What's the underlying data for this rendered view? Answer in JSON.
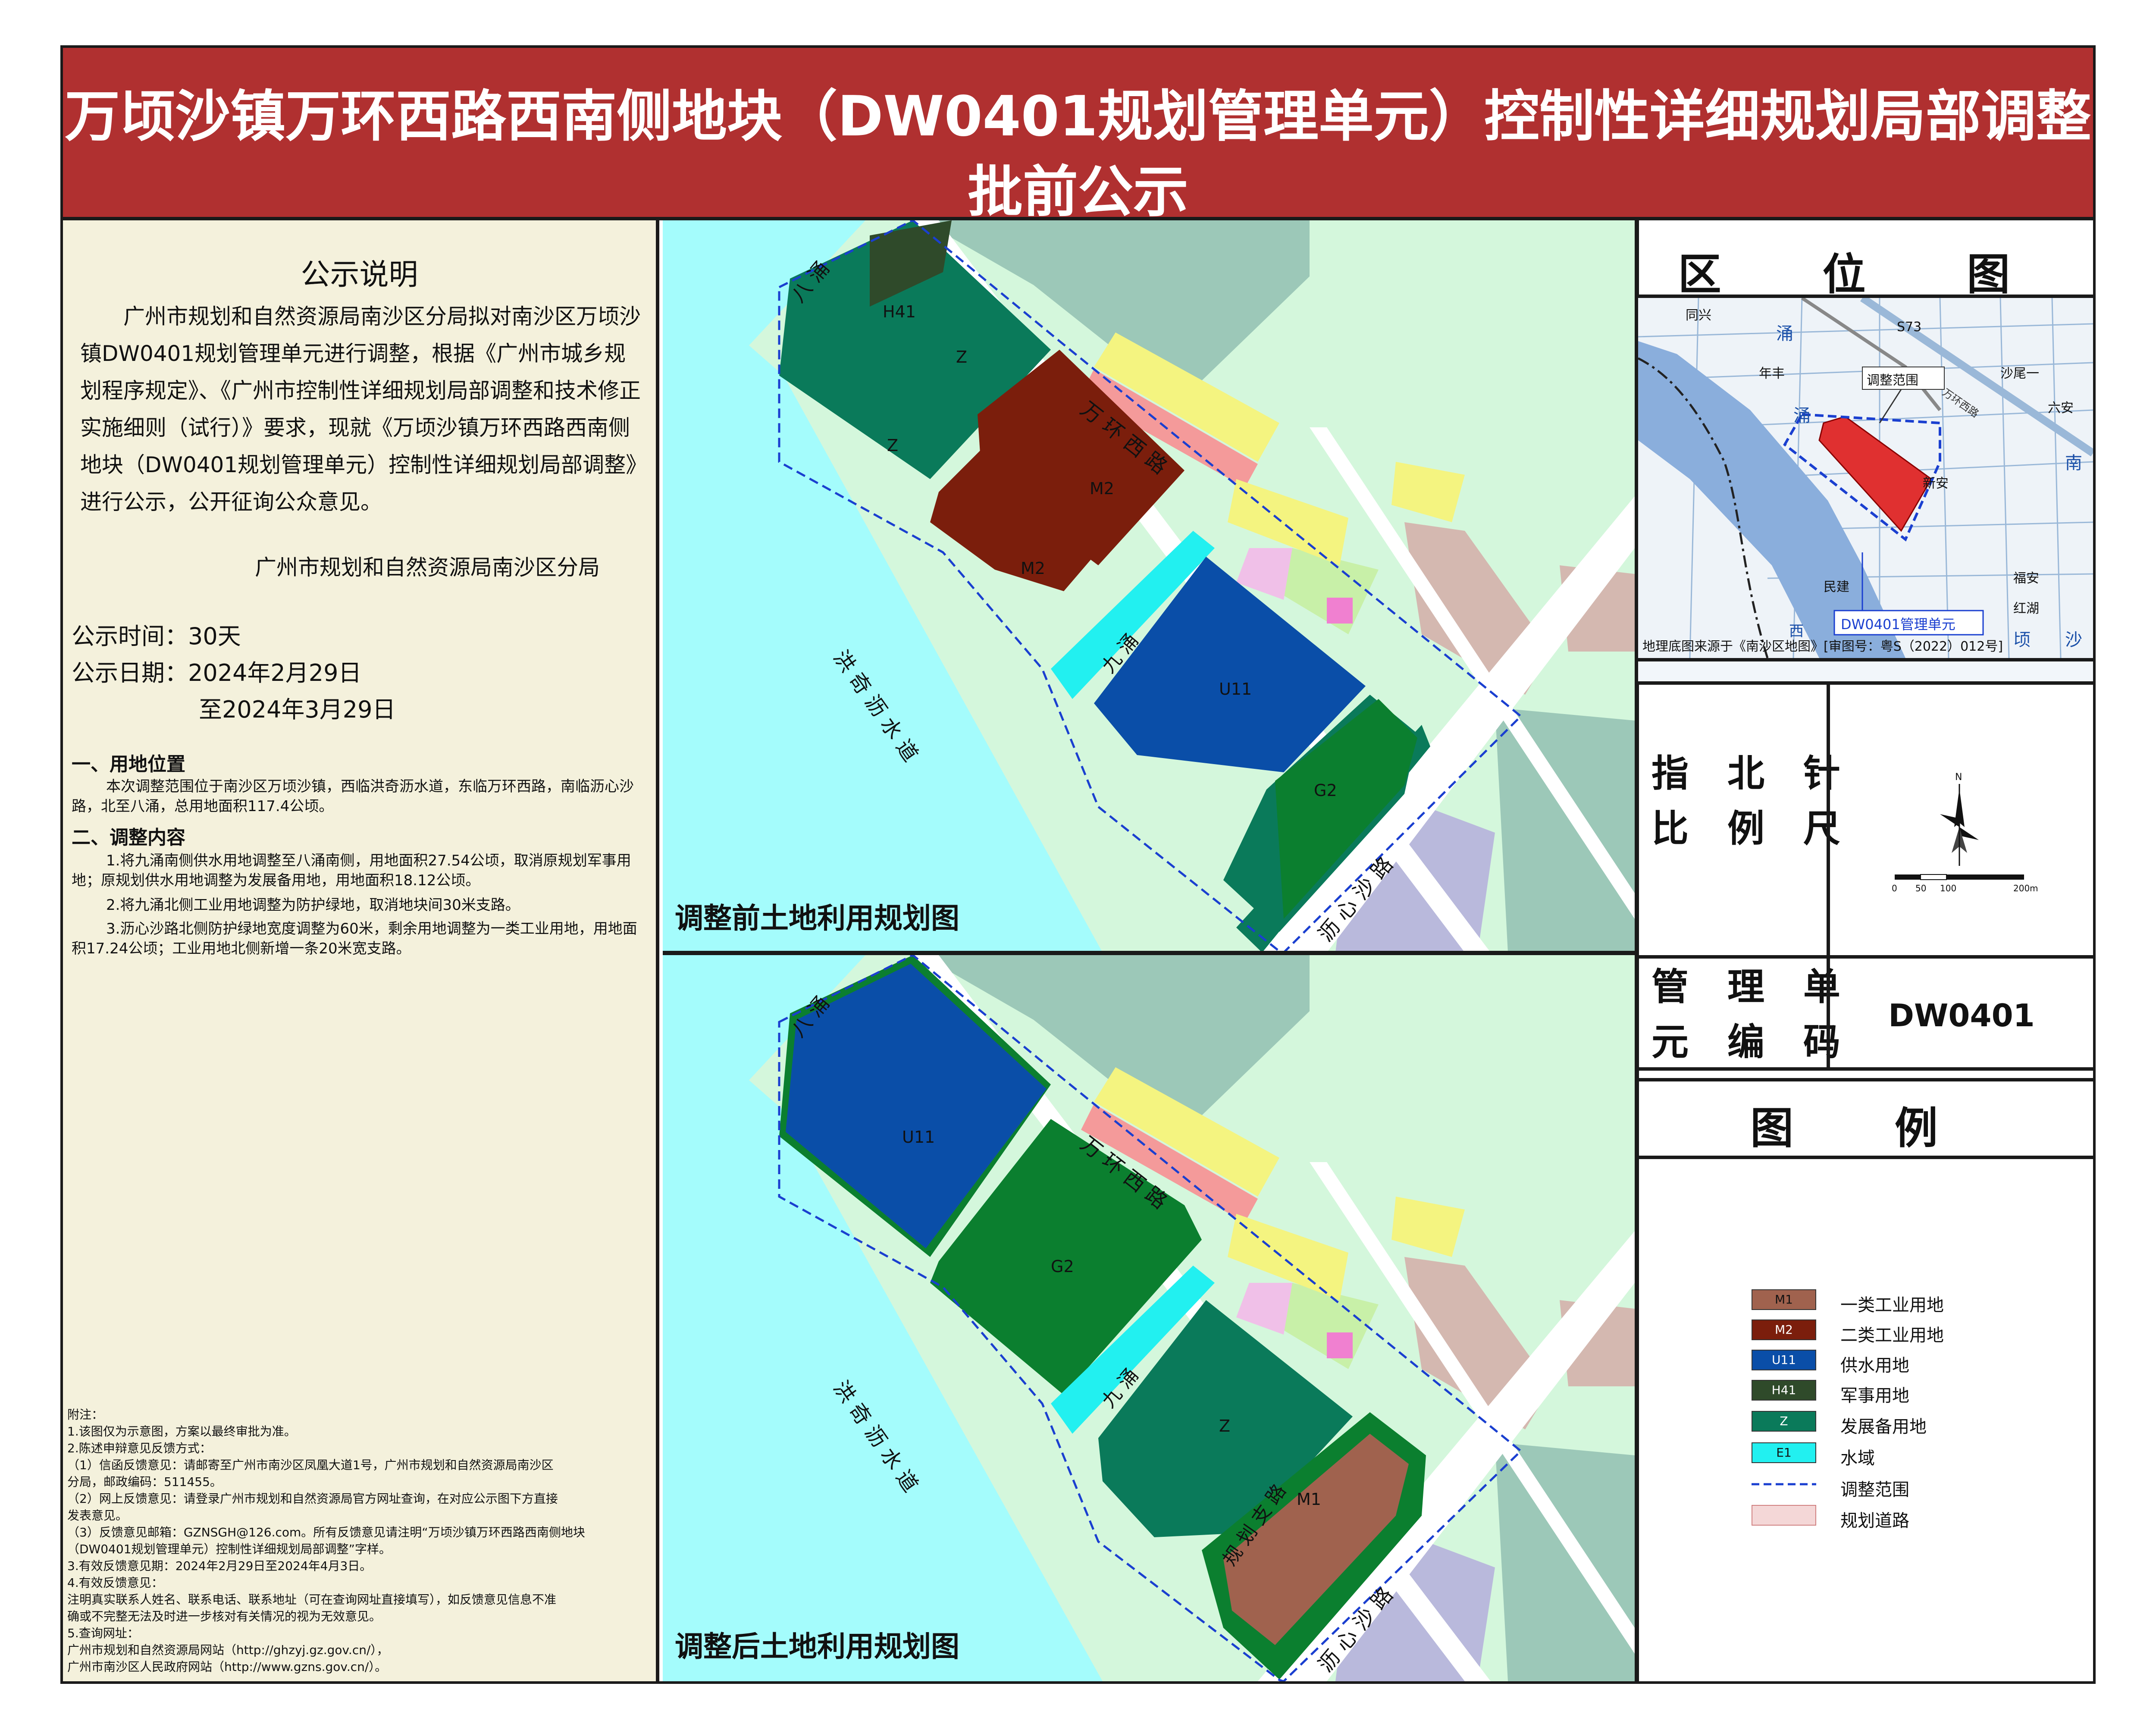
{
  "title": {
    "line1": "万顷沙镇万环西路西南侧地块（DW0401规划管理单元）控制性详细规划局部调整",
    "line2": "批前公示"
  },
  "notice": {
    "heading": "公示说明",
    "body": "广州市规划和自然资源局南沙区分局拟对南沙区万顷沙镇DW0401规划管理单元进行调整，根据《广州市城乡规划程序规定》、《广州市控制性详细规划局部调整和技术修正实施细则（试行）》要求，现就《万顷沙镇万环西路西南侧地块（DW0401规划管理单元）控制性详细规划局部调整》进行公示，公开征询公众意见。",
    "department": "广州市规划和自然资源局南沙区分局",
    "period": "公示时间：30天",
    "date_from": "公示日期：2024年2月29日",
    "date_to": "至2024年3月29日",
    "section1_title": "一、用地位置",
    "section1_text": "本次调整范围位于南沙区万顷沙镇，西临洪奇沥水道，东临万环西路，南临沥心沙路，北至八涌，总用地面积117.4公顷。",
    "section2_title": "二、调整内容",
    "section2_items": [
      "1.将九涌南侧供水用地调整至八涌南侧，用地面积27.54公顷，取消原规划军事用地；原规划供水用地调整为发展备用地，用地面积18.12公顷。",
      "2.将九涌北侧工业用地调整为防护绿地，取消地块间30米支路。",
      "3.沥心沙路北侧防护绿地宽度调整为60米，剩余用地调整为一类工业用地，用地面积17.24公顷；工业用地北侧新增一条20米宽支路。"
    ],
    "notes": [
      "附注：",
      "1.该图仅为示意图，方案以最终审批为准。",
      "2.陈述申辩意见反馈方式：",
      "（1）信函反馈意见：请邮寄至广州市南沙区凤凰大道1号，广州市规划和自然资源局南沙区",
      "分局，邮政编码：511455。",
      "（2）网上反馈意见：请登录广州市规划和自然资源局官方网址查询，在对应公示图下方直接",
      "发表意见。",
      "（3）反馈意见邮箱：GZNSGH@126.com。所有反馈意见请注明“万顷沙镇万环西路西南侧地块",
      "（DW0401规划管理单元）控制性详细规划局部调整”字样。",
      "3.有效反馈意见期：2024年2月29日至2024年4月3日。",
      "4.有效反馈意见：",
      "注明真实联系人姓名、联系电话、联系地址（可在查询网址直接填写），如反馈意见信息不准",
      "确或不完整无法及时进一步核对有关情况的视为无效意见。",
      "5.查询网址：",
      "  广州市规划和自然资源局网站（http://ghzyj.gz.gov.cn/），",
      "  广州市南沙区人民政府网站（http://www.gzns.gov.cn/）。"
    ]
  },
  "map_before": {
    "caption": "调整前土地利用规划图",
    "labels": {
      "h41": "H41",
      "z1": "Z",
      "z2": "Z",
      "m2a": "M2",
      "m2b": "M2",
      "u11": "U11",
      "g2": "G2",
      "road_east": "万 环 西 路",
      "road_south": "沥 心 沙 路",
      "water": "洪 奇 沥 水 道",
      "canal8": "八 涌",
      "canal9": "九 涌"
    }
  },
  "map_after": {
    "caption": "调整后土地利用规划图",
    "labels": {
      "u11": "U11",
      "g2": "G2",
      "z": "Z",
      "m1": "M1",
      "road_east": "万 环 西 路",
      "road_south": "沥 心 沙 路",
      "water": "洪 奇 沥 水 道",
      "canal8": "八 涌",
      "canal9": "九 涌",
      "branch": "规 划 支 路"
    }
  },
  "location_map": {
    "title": "区 位 图",
    "range_label": "调整范围",
    "unit_label": "DW0401管理单元",
    "places": [
      "同兴",
      "年丰",
      "沙尾一",
      "六安",
      "新安",
      "民建",
      "福安",
      "红湖",
      "西",
      "顷",
      "沙",
      "涌",
      "南",
      "S73",
      "万环西路",
      "涌"
    ],
    "source": "地理底图来源于《南沙区地图》[审图号：粤S（2022）012号]"
  },
  "compass": {
    "label_line1": "指 北 针",
    "label_line2": "比 例 尺",
    "north": "N",
    "scale_ticks": [
      "0",
      "50",
      "100",
      "200m"
    ]
  },
  "unit": {
    "label_line1": "管 理 单",
    "label_line2": "元 编 码",
    "code": "DW0401"
  },
  "legend": {
    "title": "图 例",
    "items": [
      {
        "code": "M1",
        "label": "一类工业用地",
        "color": "#a0624e"
      },
      {
        "code": "M2",
        "label": "二类工业用地",
        "color": "#7b1e0c"
      },
      {
        "code": "U11",
        "label": "供水用地",
        "color": "#0a4ea8"
      },
      {
        "code": "H41",
        "label": "军事用地",
        "color": "#2f4a2a"
      },
      {
        "code": "Z",
        "label": "发展备用地",
        "color": "#0a7a5a"
      },
      {
        "code": "E1",
        "label": "水域",
        "color": "#22f0f0"
      },
      {
        "code": "",
        "label": "调整范围",
        "color": "#1a3fd0"
      },
      {
        "code": "",
        "label": "规划道路",
        "color": "#f4d7d7"
      }
    ]
  }
}
